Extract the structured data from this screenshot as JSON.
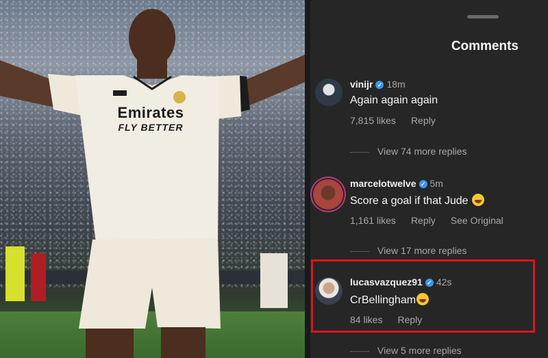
{
  "panel": {
    "title": "Comments"
  },
  "photo": {
    "shirt_text_line1": "Emirates",
    "shirt_text_line2": "FLY BETTER"
  },
  "comments": [
    {
      "username": "vinijr",
      "verified": true,
      "time": "18m",
      "text": "Again again again",
      "likes": "7,815 likes",
      "reply_label": "Reply",
      "extra_action": "",
      "view_replies": "View 74 more replies"
    },
    {
      "username": "marcelotwelve",
      "verified": true,
      "time": "5m",
      "text": "Score a goal if that Jude",
      "emoji": "grinning-face",
      "likes": "1,161 likes",
      "reply_label": "Reply",
      "extra_action": "See Original",
      "view_replies": "View 17 more replies"
    },
    {
      "username": "lucasvazquez91",
      "verified": true,
      "time": "42s",
      "text": "CrBellingham",
      "emoji": "tears-of-joy",
      "likes": "84 likes",
      "reply_label": "Reply",
      "extra_action": "",
      "view_replies": "View 5 more replies"
    }
  ],
  "colors": {
    "panel_bg": "#262626",
    "verified": "#3897f0",
    "highlight": "#e0141a"
  }
}
